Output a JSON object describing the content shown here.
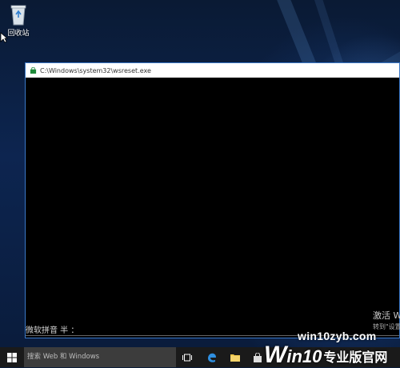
{
  "desktop": {
    "recycle_bin_label": "回收站"
  },
  "console_window": {
    "title": "C:\\Windows\\system32\\wsreset.exe",
    "ime_status": "微软拼音 半 ："
  },
  "activation_notice": {
    "line1": "激活 W",
    "line2": "转到\"设置"
  },
  "taskbar": {
    "search_placeholder": "搜索 Web 和 Windows"
  },
  "watermark": {
    "site": "win10zyb.com",
    "brand_w": "W",
    "brand_in10": "in10",
    "brand_cn": "专业版官网"
  },
  "colors": {
    "window_border": "#3a78c8",
    "taskbar": "#1a1a1a",
    "search_box": "#3c3c3c"
  }
}
